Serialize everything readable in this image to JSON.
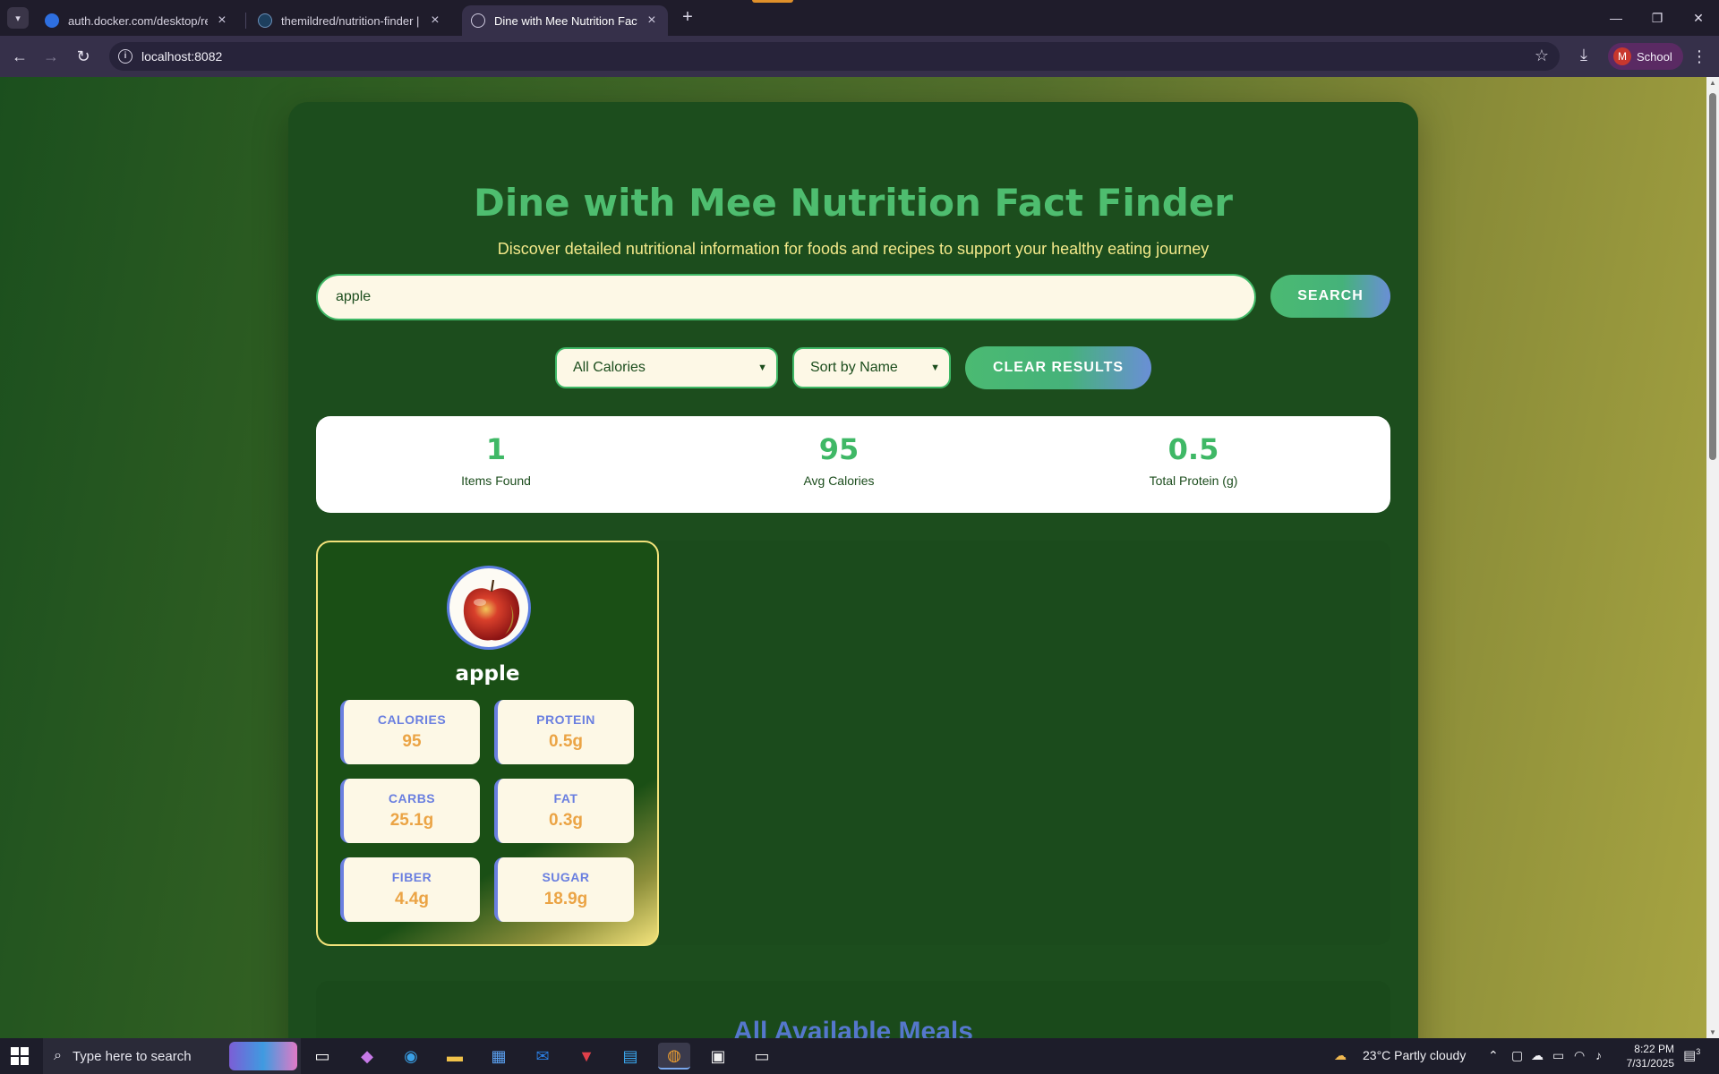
{
  "browser": {
    "tabs": [
      {
        "title": "auth.docker.com/desktop/redir",
        "active": false
      },
      {
        "title": "themildred/nutrition-finder | Do",
        "active": false
      },
      {
        "title": "Dine with Mee Nutrition Fact Fi",
        "active": true
      }
    ],
    "url": "localhost:8082",
    "profile_initial": "M",
    "profile_label": "School"
  },
  "page": {
    "title": "Dine with Mee Nutrition Fact Finder",
    "subtitle": "Discover detailed nutritional information for foods and recipes to support your healthy eating journey",
    "search_value": "apple",
    "search_button": "SEARCH",
    "calorie_filter": "All Calories",
    "sort_option": "Sort by Name",
    "clear_button": "CLEAR RESULTS",
    "stats": [
      {
        "value": "1",
        "label": "Items Found"
      },
      {
        "value": "95",
        "label": "Avg Calories"
      },
      {
        "value": "0.5",
        "label": "Total Protein (g)"
      }
    ],
    "food": {
      "name": "apple",
      "nutrients": [
        {
          "label": "CALORIES",
          "value": "95"
        },
        {
          "label": "PROTEIN",
          "value": "0.5g"
        },
        {
          "label": "CARBS",
          "value": "25.1g"
        },
        {
          "label": "FAT",
          "value": "0.3g"
        },
        {
          "label": "FIBER",
          "value": "4.4g"
        },
        {
          "label": "SUGAR",
          "value": "18.9g"
        }
      ]
    },
    "lower_heading": "All Available Meals"
  },
  "taskbar": {
    "search_placeholder": "Type here to search",
    "weather": "23°C  Partly cloudy",
    "time": "8:22 PM",
    "date": "7/31/2025",
    "notification_count": "3"
  }
}
